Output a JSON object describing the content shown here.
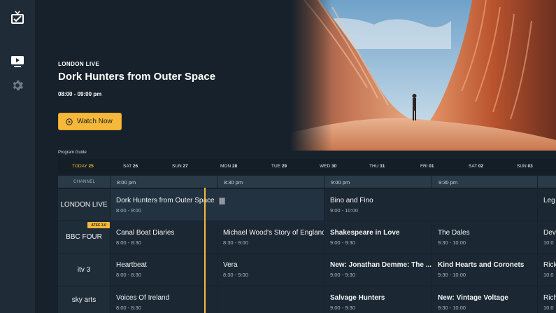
{
  "rail": {
    "icons": [
      "app-logo-icon",
      "tv-icon",
      "gear-icon"
    ]
  },
  "hero": {
    "channel": "LONDON LIVE",
    "title": "Dork Hunters from Outer Space",
    "time": "08:00 - 09:00 pm",
    "watch_label": "Watch Now"
  },
  "guide": {
    "label": "Program Guide",
    "days": [
      {
        "name": "TODAY",
        "num": "25",
        "today": true
      },
      {
        "name": "SAT",
        "num": "26"
      },
      {
        "name": "SUN",
        "num": "27"
      },
      {
        "name": "MON",
        "num": "28"
      },
      {
        "name": "TUE",
        "num": "29"
      },
      {
        "name": "WED",
        "num": "30"
      },
      {
        "name": "THU",
        "num": "31"
      },
      {
        "name": "FRI",
        "num": "01"
      },
      {
        "name": "SAT",
        "num": "02"
      },
      {
        "name": "SUN",
        "num": "03"
      }
    ],
    "channel_header": "CHANNEL",
    "times": [
      "8:00 pm",
      "8:30 pm",
      "9:00 pm",
      "9:30 pm"
    ],
    "rows": [
      {
        "channel": "LONDON LIVE",
        "programs": [
          {
            "title": "Dork Hunters from Outer Space",
            "time": "8:00 - 9:00",
            "live": true
          },
          {
            "title": "Bino and Fino",
            "time": "9:00 - 10:00"
          },
          {
            "title": "Leg",
            "time": ""
          }
        ]
      },
      {
        "channel": "BBC FOUR",
        "badge": "ATSC 3.0",
        "programs": [
          {
            "title": "Canal Boat Diaries",
            "time": "8:00 - 8:30"
          },
          {
            "title": "Michael Wood's Story of England",
            "time": "8:30 - 9:00"
          },
          {
            "title": "Shakespeare in Love",
            "time": "9:00 - 9:30",
            "bold": true
          },
          {
            "title": "The Dales",
            "time": "9:30 - 10:00"
          },
          {
            "title": "Dev",
            "time": "10:0"
          }
        ]
      },
      {
        "channel": "itv 3",
        "programs": [
          {
            "title": "Heartbeat",
            "time": "8:00 - 8:30"
          },
          {
            "title": "Vera",
            "time": "8:30 - 9:00"
          },
          {
            "title": "New: Jonathan Demme: The ...",
            "time": "9:00 - 9:30",
            "bold": true
          },
          {
            "title": "Kind Hearts and Coronets",
            "time": "9:30 - 10:00",
            "bold": true
          },
          {
            "title": "Rick",
            "time": "10:0"
          }
        ]
      },
      {
        "channel": "sky arts",
        "programs": [
          {
            "title": "Voices Of Ireland",
            "time": "8:00 - 8:30"
          },
          {
            "title": "",
            "time": ""
          },
          {
            "title": "Salvage Hunters",
            "time": "9:00 - 9:30",
            "bold": true
          },
          {
            "title": "New: Vintage Voltage",
            "time": "9:30 - 10:00",
            "bold": true
          },
          {
            "title": "Rich",
            "time": "10:0"
          }
        ]
      }
    ]
  },
  "colors": {
    "accent": "#f6b83a",
    "background": "#16212b",
    "rail": "#1f2c37"
  }
}
